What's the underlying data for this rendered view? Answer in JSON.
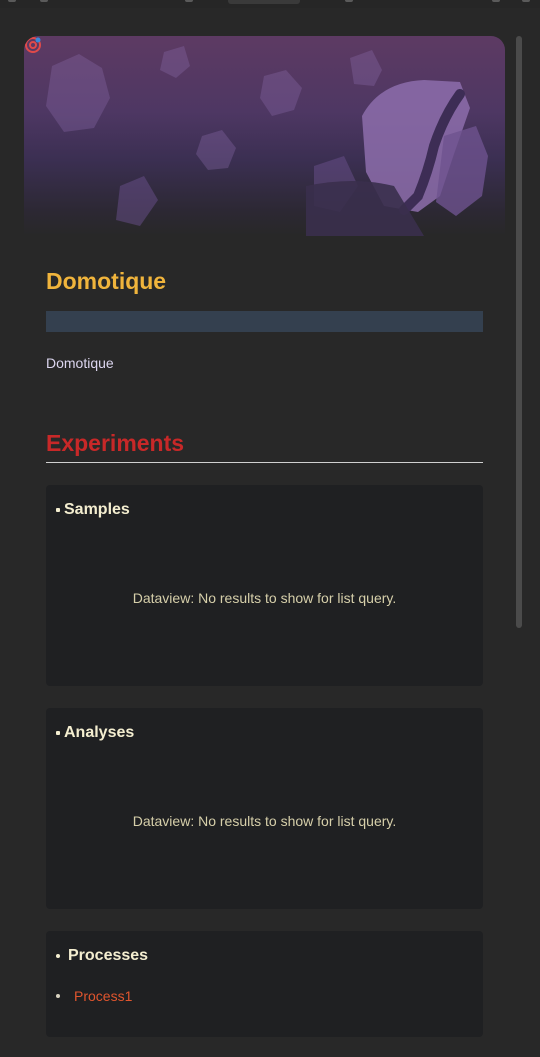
{
  "note": {
    "title": "Domotique",
    "subtitle": "Domotique"
  },
  "section": {
    "heading": "Experiments"
  },
  "cards": [
    {
      "title": "Samples",
      "message": "Dataview: No results to show for list query."
    },
    {
      "title": "Analyses",
      "message": "Dataview: No results to show for list query."
    },
    {
      "title": "Processes",
      "items": [
        "Process1"
      ]
    }
  ],
  "colors": {
    "title": "#f0b43c",
    "heading": "#c82828",
    "link": "#e0552e",
    "background": "#282828",
    "card": "#1f2022"
  },
  "icons": {
    "banner": "target-icon"
  }
}
